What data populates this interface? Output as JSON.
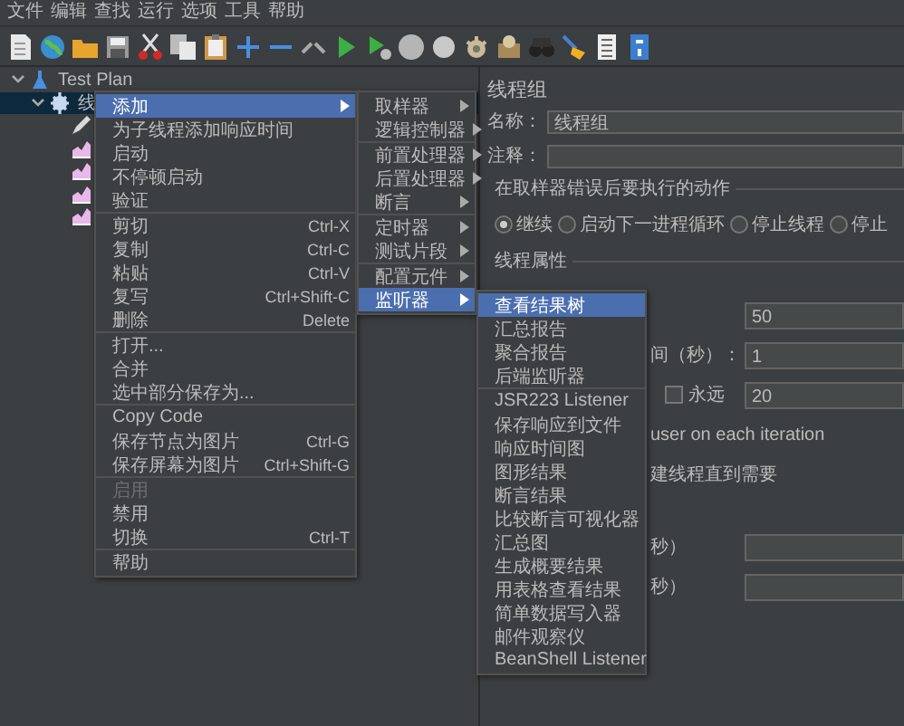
{
  "menu_bar": [
    "文件",
    "编辑",
    "查找",
    "运行",
    "选项",
    "工具",
    "帮助"
  ],
  "tree": [
    {
      "label": "Test Plan",
      "kind": "plan",
      "expanded": true,
      "selected": false,
      "children": [
        {
          "label": "线",
          "kind": "thread_group",
          "expanded": true,
          "selected": true,
          "children": [
            {
              "kind": "config",
              "selected": false
            },
            {
              "kind": "listener",
              "selected": false
            },
            {
              "kind": "listener",
              "selected": false
            },
            {
              "kind": "listener",
              "selected": false
            },
            {
              "kind": "listener",
              "selected": false
            }
          ]
        }
      ]
    }
  ],
  "context_menu": {
    "items": [
      {
        "kind": "item",
        "label": "添加",
        "selected": true,
        "disabled": false,
        "submenu": true
      },
      {
        "kind": "item",
        "label": "为子线程添加响应时间",
        "selected": false,
        "disabled": false,
        "submenu": false
      },
      {
        "kind": "item",
        "label": "启动",
        "selected": false,
        "disabled": false,
        "submenu": false
      },
      {
        "kind": "item",
        "label": "不停顿启动",
        "selected": false,
        "disabled": false,
        "submenu": false
      },
      {
        "kind": "item",
        "label": "验证",
        "selected": false,
        "disabled": false,
        "submenu": false
      },
      {
        "kind": "separator"
      },
      {
        "kind": "item",
        "label": "剪切",
        "shortcut": "Ctrl-X",
        "selected": false,
        "disabled": false,
        "submenu": false
      },
      {
        "kind": "item",
        "label": "复制",
        "shortcut": "Ctrl-C",
        "selected": false,
        "disabled": false,
        "submenu": false
      },
      {
        "kind": "item",
        "label": "粘贴",
        "shortcut": "Ctrl-V",
        "selected": false,
        "disabled": false,
        "submenu": false
      },
      {
        "kind": "item",
        "label": "复写",
        "shortcut": "Ctrl+Shift-C",
        "selected": false,
        "disabled": false,
        "submenu": false
      },
      {
        "kind": "item",
        "label": "删除",
        "shortcut": "Delete",
        "selected": false,
        "disabled": false,
        "submenu": false
      },
      {
        "kind": "separator"
      },
      {
        "kind": "item",
        "label": "打开...",
        "selected": false,
        "disabled": false,
        "submenu": false
      },
      {
        "kind": "item",
        "label": "合并",
        "selected": false,
        "disabled": false,
        "submenu": false
      },
      {
        "kind": "item",
        "label": "选中部分保存为...",
        "selected": false,
        "disabled": false,
        "submenu": false
      },
      {
        "kind": "separator"
      },
      {
        "kind": "item",
        "label": "Copy Code",
        "selected": false,
        "disabled": false,
        "submenu": false
      },
      {
        "kind": "item",
        "label": "保存节点为图片",
        "shortcut": "Ctrl-G",
        "selected": false,
        "disabled": false,
        "submenu": false
      },
      {
        "kind": "item",
        "label": "保存屏幕为图片",
        "shortcut": "Ctrl+Shift-G",
        "selected": false,
        "disabled": false,
        "submenu": false
      },
      {
        "kind": "separator"
      },
      {
        "kind": "item",
        "label": "启用",
        "selected": false,
        "disabled": true,
        "submenu": false
      },
      {
        "kind": "item",
        "label": "禁用",
        "selected": false,
        "disabled": false,
        "submenu": false
      },
      {
        "kind": "item",
        "label": "切换",
        "shortcut": "Ctrl-T",
        "selected": false,
        "disabled": false,
        "submenu": false
      },
      {
        "kind": "separator"
      },
      {
        "kind": "item",
        "label": "帮助",
        "selected": false,
        "disabled": false,
        "submenu": false
      }
    ]
  },
  "add_submenu": {
    "items": [
      {
        "kind": "item",
        "label": "取样器",
        "selected": false,
        "disabled": false,
        "submenu": true
      },
      {
        "kind": "item",
        "label": "逻辑控制器",
        "selected": false,
        "disabled": false,
        "submenu": true
      },
      {
        "kind": "separator"
      },
      {
        "kind": "item",
        "label": "前置处理器",
        "selected": false,
        "disabled": false,
        "submenu": true
      },
      {
        "kind": "item",
        "label": "后置处理器",
        "selected": false,
        "disabled": false,
        "submenu": true
      },
      {
        "kind": "item",
        "label": "断言",
        "selected": false,
        "disabled": false,
        "submenu": true
      },
      {
        "kind": "separator"
      },
      {
        "kind": "item",
        "label": "定时器",
        "selected": false,
        "disabled": false,
        "submenu": true
      },
      {
        "kind": "item",
        "label": "测试片段",
        "selected": false,
        "disabled": false,
        "submenu": true
      },
      {
        "kind": "separator"
      },
      {
        "kind": "item",
        "label": "配置元件",
        "selected": false,
        "disabled": false,
        "submenu": true
      },
      {
        "kind": "item",
        "label": "监听器",
        "selected": true,
        "disabled": false,
        "submenu": true
      }
    ]
  },
  "listener_submenu": {
    "items": [
      {
        "kind": "item",
        "label": "查看结果树",
        "selected": true,
        "disabled": false,
        "submenu": false
      },
      {
        "kind": "item",
        "label": "汇总报告",
        "selected": false,
        "disabled": false,
        "submenu": false
      },
      {
        "kind": "item",
        "label": "聚合报告",
        "selected": false,
        "disabled": false,
        "submenu": false
      },
      {
        "kind": "item",
        "label": "后端监听器",
        "selected": false,
        "disabled": false,
        "submenu": false
      },
      {
        "kind": "separator"
      },
      {
        "kind": "item",
        "label": "JSR223 Listener",
        "selected": false,
        "disabled": false,
        "submenu": false
      },
      {
        "kind": "item",
        "label": "保存响应到文件",
        "selected": false,
        "disabled": false,
        "submenu": false
      },
      {
        "kind": "item",
        "label": "响应时间图",
        "selected": false,
        "disabled": false,
        "submenu": false
      },
      {
        "kind": "item",
        "label": "图形结果",
        "selected": false,
        "disabled": false,
        "submenu": false
      },
      {
        "kind": "item",
        "label": "断言结果",
        "selected": false,
        "disabled": false,
        "submenu": false
      },
      {
        "kind": "item",
        "label": "比较断言可视化器",
        "selected": false,
        "disabled": false,
        "submenu": false
      },
      {
        "kind": "item",
        "label": "汇总图",
        "selected": false,
        "disabled": false,
        "submenu": false
      },
      {
        "kind": "item",
        "label": "生成概要结果",
        "selected": false,
        "disabled": false,
        "submenu": false
      },
      {
        "kind": "item",
        "label": "用表格查看结果",
        "selected": false,
        "disabled": false,
        "submenu": false
      },
      {
        "kind": "item",
        "label": "简单数据写入器",
        "selected": false,
        "disabled": false,
        "submenu": false
      },
      {
        "kind": "item",
        "label": "邮件观察仪",
        "selected": false,
        "disabled": false,
        "submenu": false
      },
      {
        "kind": "item",
        "label": "BeanShell Listener",
        "selected": false,
        "disabled": false,
        "submenu": false
      }
    ]
  },
  "panel": {
    "title": "线程组",
    "name_label": "名称：",
    "name_value": "线程组",
    "comment_label": "注释：",
    "error_action": {
      "label": "在取样器错误后要执行的动作",
      "options": [
        {
          "label": "继续",
          "selected": true
        },
        {
          "label": "启动下一进程循环",
          "selected": false
        },
        {
          "label": "停止线程",
          "selected": false
        },
        {
          "label": "停止",
          "selected": false
        }
      ]
    },
    "thread_properties": {
      "label": "线程属性",
      "rows": [
        {
          "kind": "field",
          "value": "50"
        },
        {
          "kind": "field",
          "label": "间（秒）：",
          "value": "1"
        },
        {
          "kind": "checkfield",
          "label": "永远",
          "checked": false,
          "value": "20"
        },
        {
          "kind": "text",
          "label": "user on each iteration"
        },
        {
          "kind": "text",
          "label": "建线程直到需要"
        },
        {
          "kind": "field",
          "label": "秒）"
        },
        {
          "kind": "field",
          "label": "秒）"
        }
      ]
    }
  }
}
